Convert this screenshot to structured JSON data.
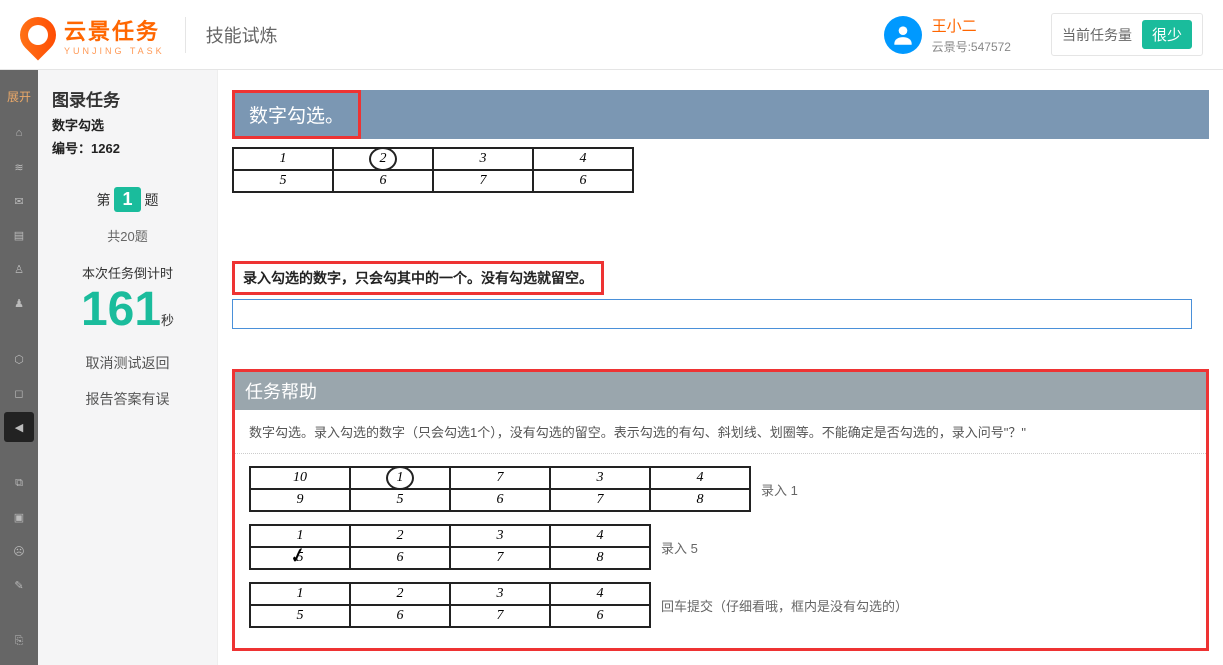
{
  "header": {
    "logo_main": "云景任务",
    "logo_sub": "YUNJING TASK",
    "page_title": "技能试炼",
    "user_name": "王小二",
    "user_id_label": "云景号:547572",
    "load_label": "当前任务量",
    "load_value": "很少"
  },
  "rail": {
    "expand_label": "展开"
  },
  "side": {
    "title": "图录任务",
    "task_type": "数字勾选",
    "task_num": "编号：1262",
    "q_prefix": "第",
    "q_no": "1",
    "q_suffix": "题",
    "total": "共20题",
    "countdown_label": "本次任务倒计时",
    "countdown_value": "161",
    "countdown_unit": "秒",
    "cancel": "取消测试返回",
    "report": "报告答案有误"
  },
  "main": {
    "section_title": "数字勾选。",
    "grid": [
      [
        "1",
        "2",
        "3",
        "4"
      ],
      [
        "5",
        "6",
        "7",
        "6"
      ]
    ],
    "grid_circled_index": [
      0,
      1
    ],
    "prompt": "录入勾选的数字，只会勾其中的一个。没有勾选就留空。",
    "input_value": ""
  },
  "help": {
    "title": "任务帮助",
    "desc": "数字勾选。录入勾选的数字（只会勾选1个），没有勾选的留空。表示勾选的有勾、斜划线、划圈等。不能确定是否勾选的，录入问号\"？\"",
    "examples": [
      {
        "rows": [
          [
            "10",
            "1",
            "7",
            "3",
            "4"
          ],
          [
            "9",
            "5",
            "6",
            "7",
            "8"
          ]
        ],
        "circled": [
          0,
          1
        ],
        "hint": "录入 1"
      },
      {
        "rows": [
          [
            "1",
            "2",
            "3",
            "4"
          ],
          [
            "5",
            "6",
            "7",
            "8"
          ]
        ],
        "checked": [
          1,
          0
        ],
        "hint": "录入 5"
      },
      {
        "rows": [
          [
            "1",
            "2",
            "3",
            "4"
          ],
          [
            "5",
            "6",
            "7",
            "6"
          ]
        ],
        "hint": "回车提交（仔细看哦，框内是没有勾选的）"
      }
    ]
  }
}
